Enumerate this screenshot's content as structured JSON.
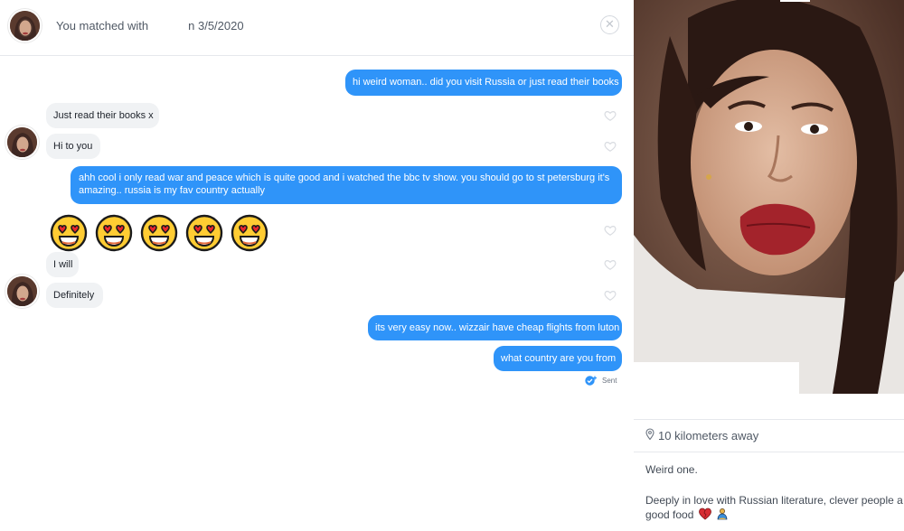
{
  "header": {
    "matched_prefix": "You matched with",
    "matched_suffix": "n 3/5/2020",
    "close_icon": "close-icon"
  },
  "messages": [
    {
      "from": "me",
      "text": "hi weird woman.. did you visit Russia or just read their books"
    },
    {
      "from": "match",
      "text": "Just read their books x"
    },
    {
      "from": "match",
      "text": "Hi to you"
    },
    {
      "from": "me",
      "text": "ahh cool i only read war and peace which is quite good and i watched the bbc tv show. you should go to st petersburg it's amazing.. russia is my fav country actually"
    },
    {
      "from": "match",
      "emoji": "heart-eyes-emoji",
      "count": 5
    },
    {
      "from": "match",
      "text": "I will"
    },
    {
      "from": "match",
      "text": "Definitely"
    },
    {
      "from": "me",
      "text": "its very easy now.. wizzair have cheap flights from luton"
    },
    {
      "from": "me",
      "text": "what country are you from"
    }
  ],
  "status": {
    "sent_label": "Sent"
  },
  "profile": {
    "distance": "10 kilometers away",
    "bio_line1": "Weird one.",
    "bio_line2": "Deeply in love with Russian literature, clever people a",
    "bio_line3": "good food"
  },
  "colors": {
    "outgoing_bubble": "#2f94f9",
    "incoming_bubble": "#f0f2f4",
    "like_heart": "#d8dbe0"
  }
}
